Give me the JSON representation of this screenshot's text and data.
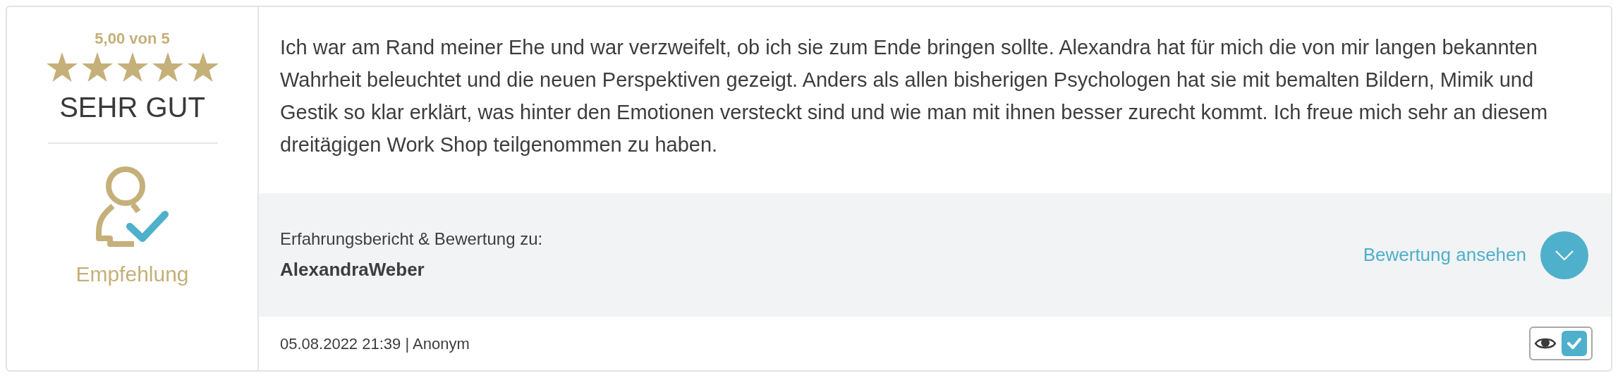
{
  "rating": {
    "score": "5,00 von 5",
    "stars": 5,
    "verdict": "SEHR GUT"
  },
  "recommendation": {
    "label": "Empfehlung"
  },
  "review": {
    "text": "Ich war am Rand meiner Ehe und war verzweifelt, ob ich sie zum Ende bringen sollte. Alexandra hat für mich die von mir langen bekannten Wahrheit beleuchtet und die neuen Perspektiven gezeigt. Anders als allen bisherigen Psychologen hat sie mit bemalten Bildern, Mimik und Gestik so klar erklärt, was hinter den Emotionen versteckt sind und wie man mit ihnen besser zurecht kommt. Ich freue mich sehr an diesem dreitägigen Work Shop teilgenommen zu haben."
  },
  "subject": {
    "caption": "Erfahrungsbericht & Bewertung zu:",
    "name": "AlexandraWeber",
    "link": "Bewertung ansehen",
    "expanded": false
  },
  "footer": {
    "meta": "05.08.2022 21:39 | Anonym",
    "verified": {
      "checked": true
    }
  }
}
